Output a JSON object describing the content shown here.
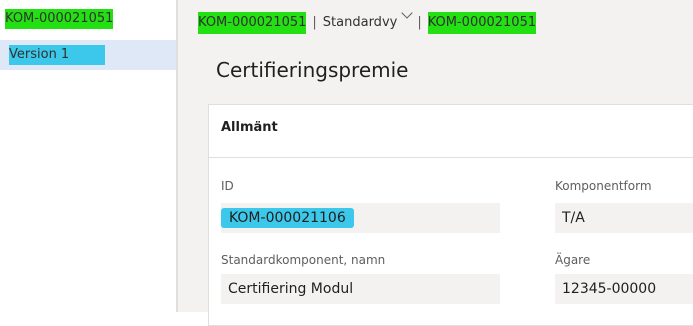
{
  "left_nav": {
    "record_id": "KOM-000021051",
    "version_label": "Version 1"
  },
  "breadcrumb": {
    "record_id": "KOM-000021051",
    "separator": "|",
    "view_name": "Standardvy",
    "record_id_2": "KOM-000021051"
  },
  "page": {
    "title": "Certifieringspremie"
  },
  "card": {
    "header": "Allmänt",
    "fields": {
      "id_label": "ID",
      "id_value": "KOM-000021106",
      "component_form_label": "Komponentform",
      "component_form_value": "T/A",
      "std_component_label": "Standardkomponent, namn",
      "std_component_value": "Certifiering Modul",
      "owner_label": "Ägare",
      "owner_value": "12345-00000"
    }
  },
  "colors": {
    "highlight_green": "#22e012",
    "highlight_blue": "#3bc8ea",
    "selected_nav_bg": "#dfe8f6"
  },
  "icons": {
    "view_dropdown": "chevron-down-icon"
  }
}
